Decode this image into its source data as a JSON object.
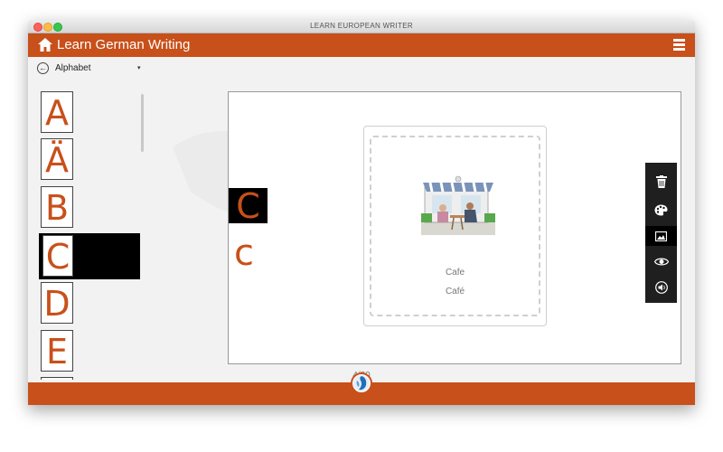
{
  "window": {
    "title": "LEARN EUROPEAN WRITER"
  },
  "appbar": {
    "title": "Learn German Writing",
    "home_icon": "home-icon",
    "menu_icon": "hamburger-menu-icon"
  },
  "category": {
    "selected": "Alphabet",
    "back_icon": "back-arrow-icon",
    "caret": "▾"
  },
  "letters": [
    "A",
    "Ä",
    "B",
    "C",
    "D",
    "E"
  ],
  "selected_letter": {
    "upper": "C",
    "lower": "c"
  },
  "card": {
    "word": "Cafe",
    "word_native": "Café",
    "image": "cafe-illustration"
  },
  "tools": [
    "trash-icon",
    "palette-icon",
    "image-icon",
    "eye-icon",
    "speaker-icon"
  ],
  "pager": {
    "text": "4/30"
  },
  "colors": {
    "accent": "#c8501a",
    "toolbar": "#1f1f1f"
  }
}
